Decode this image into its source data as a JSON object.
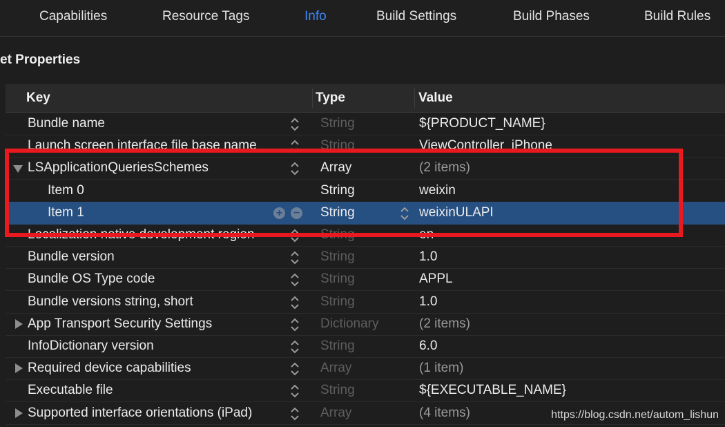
{
  "tabs": [
    {
      "label": "Capabilities",
      "active": false
    },
    {
      "label": "Resource Tags",
      "active": false
    },
    {
      "label": "Info",
      "active": true
    },
    {
      "label": "Build Settings",
      "active": false
    },
    {
      "label": "Build Phases",
      "active": false
    },
    {
      "label": "Build Rules",
      "active": false
    }
  ],
  "section_title": "et Properties",
  "columns": {
    "key": "Key",
    "type": "Type",
    "value": "Value"
  },
  "rows": [
    {
      "key": "Bundle name",
      "type": "String",
      "value": "${PRODUCT_NAME}",
      "type_dim": true,
      "value_muted": false,
      "disclosure": "none",
      "indent": 0,
      "stepper": true
    },
    {
      "key": "Launch screen interface file base name",
      "type": "String",
      "value": "ViewController_iPhone",
      "type_dim": true,
      "value_muted": false,
      "disclosure": "none",
      "indent": 0,
      "stepper": true
    },
    {
      "key": "LSApplicationQueriesSchemes",
      "type": "Array",
      "value": "(2 items)",
      "type_dim": false,
      "value_muted": true,
      "disclosure": "open",
      "indent": 0,
      "stepper": true
    },
    {
      "key": "Item 0",
      "type": "String",
      "value": "weixin",
      "type_dim": false,
      "value_muted": false,
      "disclosure": "none",
      "indent": 1,
      "stepper": false
    },
    {
      "key": "Item 1",
      "type": "String",
      "value": "weixinULAPI",
      "type_dim": false,
      "value_muted": false,
      "disclosure": "none",
      "indent": 1,
      "stepper": false,
      "selected": true
    },
    {
      "key": "Localization native development region",
      "type": "String",
      "value": "en",
      "type_dim": true,
      "value_muted": false,
      "disclosure": "none",
      "indent": 0,
      "stepper": true
    },
    {
      "key": "Bundle version",
      "type": "String",
      "value": "1.0",
      "type_dim": true,
      "value_muted": false,
      "disclosure": "none",
      "indent": 0,
      "stepper": true
    },
    {
      "key": "Bundle OS Type code",
      "type": "String",
      "value": "APPL",
      "type_dim": true,
      "value_muted": false,
      "disclosure": "none",
      "indent": 0,
      "stepper": true
    },
    {
      "key": "Bundle versions string, short",
      "type": "String",
      "value": "1.0",
      "type_dim": true,
      "value_muted": false,
      "disclosure": "none",
      "indent": 0,
      "stepper": true
    },
    {
      "key": "App Transport Security Settings",
      "type": "Dictionary",
      "value": "(2 items)",
      "type_dim": true,
      "value_muted": true,
      "disclosure": "closed",
      "indent": 0,
      "stepper": true
    },
    {
      "key": "InfoDictionary version",
      "type": "String",
      "value": "6.0",
      "type_dim": true,
      "value_muted": false,
      "disclosure": "none",
      "indent": 0,
      "stepper": true
    },
    {
      "key": "Required device capabilities",
      "type": "Array",
      "value": "(1 item)",
      "type_dim": true,
      "value_muted": true,
      "disclosure": "closed",
      "indent": 0,
      "stepper": true
    },
    {
      "key": "Executable file",
      "type": "String",
      "value": "${EXECUTABLE_NAME}",
      "type_dim": true,
      "value_muted": false,
      "disclosure": "none",
      "indent": 0,
      "stepper": true
    },
    {
      "key": "Supported interface orientations (iPad)",
      "type": "Array",
      "value": "(4 items)",
      "type_dim": true,
      "value_muted": true,
      "disclosure": "closed",
      "indent": 0,
      "stepper": true
    }
  ],
  "selected_row_buttons": {
    "add": "+",
    "remove": "−"
  },
  "watermark": "https://blog.csdn.net/autom_lishun",
  "colors": {
    "accent": "#3d86f7",
    "selection": "#264f82",
    "highlight_box": "#e8191f"
  }
}
